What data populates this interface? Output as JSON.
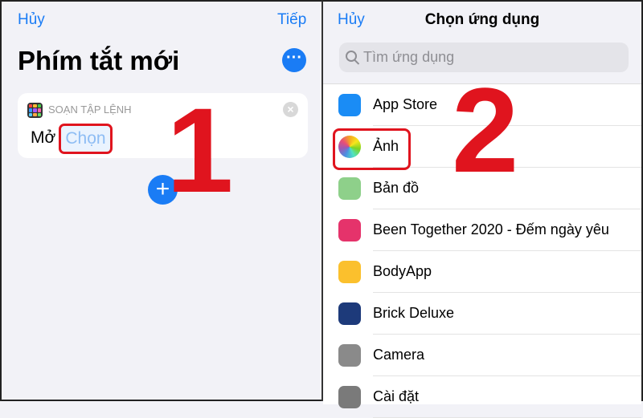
{
  "left": {
    "cancel": "Hủy",
    "next": "Tiếp",
    "title": "Phím tắt mới",
    "action": {
      "category": "SOẠN TẬP LỆNH",
      "verb": "Mở",
      "param": "Chọn"
    },
    "step": "1"
  },
  "right": {
    "cancel": "Hủy",
    "title": "Chọn ứng dụng",
    "search_placeholder": "Tìm ứng dụng",
    "step": "2",
    "apps": [
      {
        "name": "App Store",
        "icon": "app-store-icon",
        "color": "#1a8cf5"
      },
      {
        "name": "Ảnh",
        "icon": "photos-icon",
        "color": "#f5a623"
      },
      {
        "name": "Bản đồ",
        "icon": "maps-icon",
        "color": "#8ed08a"
      },
      {
        "name": "Been Together 2020 - Đếm ngày yêu",
        "icon": "been-together-icon",
        "color": "#e5336b"
      },
      {
        "name": "BodyApp",
        "icon": "bodyapp-icon",
        "color": "#fbc02d"
      },
      {
        "name": "Brick Deluxe",
        "icon": "brick-deluxe-icon",
        "color": "#1d3a7a"
      },
      {
        "name": "Camera",
        "icon": "camera-icon",
        "color": "#8a8a8a"
      },
      {
        "name": "Cài đặt",
        "icon": "settings-icon",
        "color": "#7a7a7a"
      }
    ]
  },
  "colors": {
    "accent": "#1a7cf5",
    "highlight": "#e0141e"
  }
}
